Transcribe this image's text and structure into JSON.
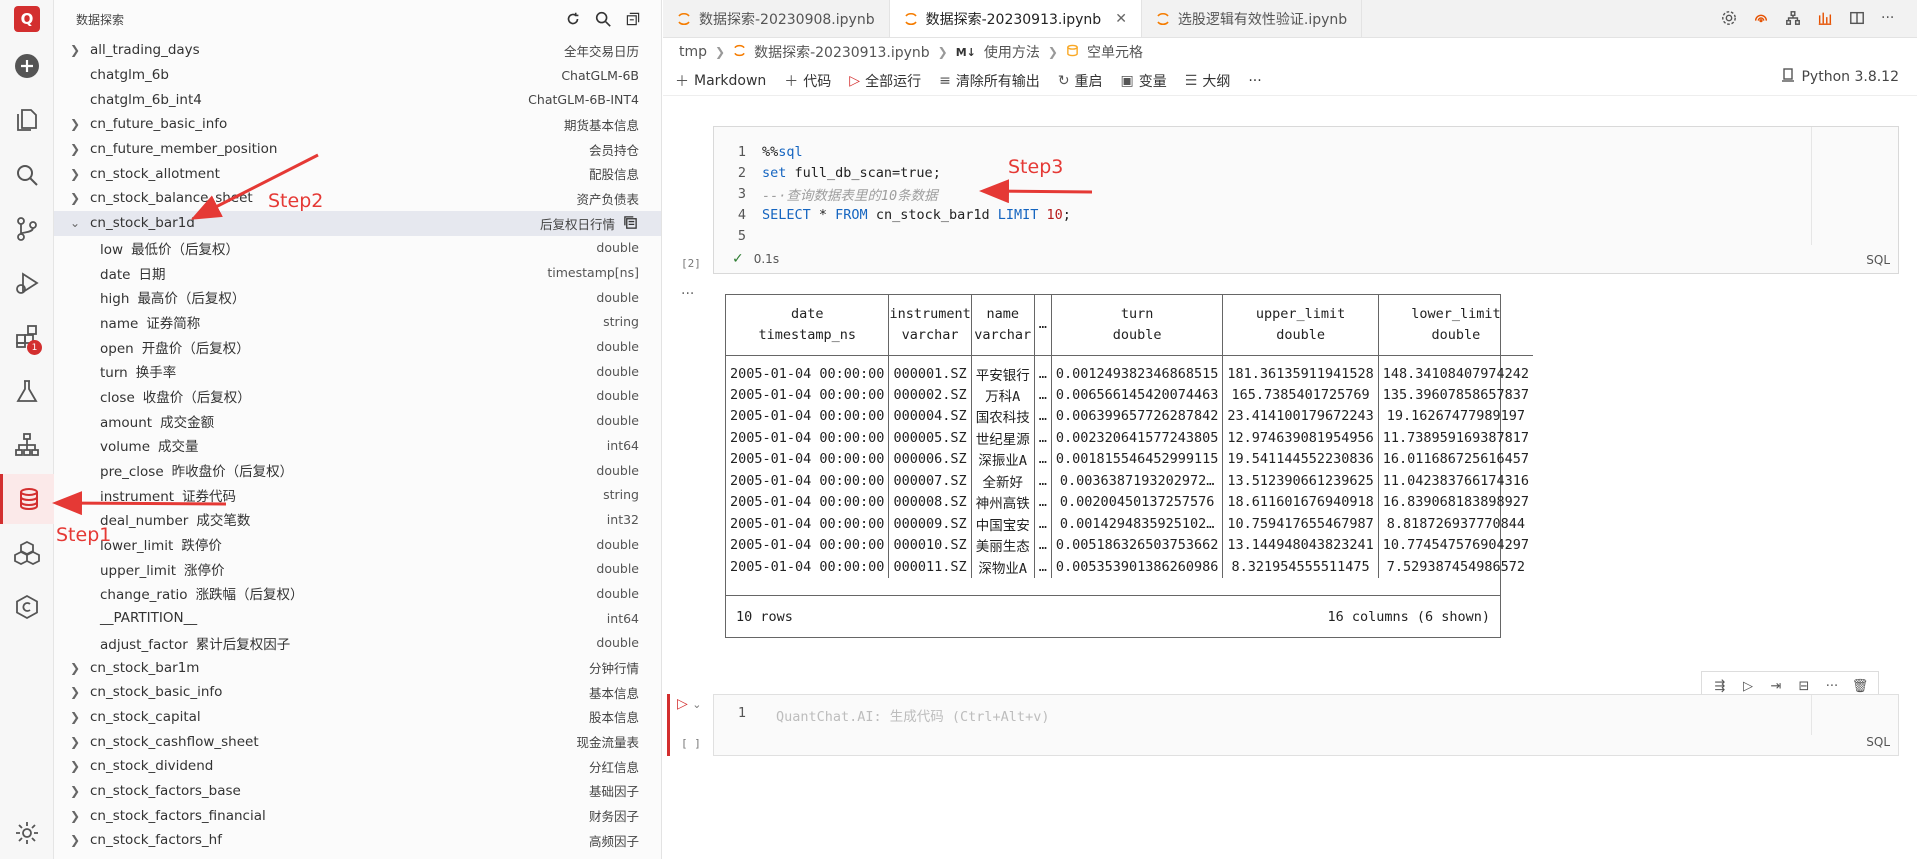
{
  "app": {
    "logo_text": "Q",
    "accent": "#d32f2f"
  },
  "activity_bar": {
    "extensions_badge": "1"
  },
  "sidebar": {
    "title": "数据探索",
    "tables_before": [
      {
        "name": "all_trading_days",
        "desc": "全年交易日历",
        "expandable": true
      },
      {
        "name": "chatglm_6b",
        "desc": "ChatGLM-6B",
        "expandable": false
      },
      {
        "name": "chatglm_6b_int4",
        "desc": "ChatGLM-6B-INT4",
        "expandable": false
      },
      {
        "name": "cn_future_basic_info",
        "desc": "期货基本信息",
        "expandable": true
      },
      {
        "name": "cn_future_member_position",
        "desc": "会员持仓",
        "expandable": true
      },
      {
        "name": "cn_stock_allotment",
        "desc": "配股信息",
        "expandable": true
      },
      {
        "name": "cn_stock_balance_sheet",
        "desc": "资产负债表",
        "expandable": true
      }
    ],
    "selected": {
      "name": "cn_stock_bar1d",
      "desc": "后复权日行情"
    },
    "columns": [
      {
        "field": "low",
        "cn": "最低价（后复权）",
        "type": "double"
      },
      {
        "field": "date",
        "cn": "日期",
        "type": "timestamp[ns]"
      },
      {
        "field": "high",
        "cn": "最高价（后复权）",
        "type": "double"
      },
      {
        "field": "name",
        "cn": "证券简称",
        "type": "string"
      },
      {
        "field": "open",
        "cn": "开盘价（后复权）",
        "type": "double"
      },
      {
        "field": "turn",
        "cn": "换手率",
        "type": "double"
      },
      {
        "field": "close",
        "cn": "收盘价（后复权）",
        "type": "double"
      },
      {
        "field": "amount",
        "cn": "成交金额",
        "type": "double"
      },
      {
        "field": "volume",
        "cn": "成交量",
        "type": "int64"
      },
      {
        "field": "pre_close",
        "cn": "昨收盘价（后复权）",
        "type": "double"
      },
      {
        "field": "instrument",
        "cn": "证券代码",
        "type": "string"
      },
      {
        "field": "deal_number",
        "cn": "成交笔数",
        "type": "int32"
      },
      {
        "field": "lower_limit",
        "cn": "跌停价",
        "type": "double"
      },
      {
        "field": "upper_limit",
        "cn": "涨停价",
        "type": "double"
      },
      {
        "field": "change_ratio",
        "cn": "涨跌幅（后复权）",
        "type": "double"
      },
      {
        "field": "__PARTITION__",
        "cn": "",
        "type": "int64"
      },
      {
        "field": "adjust_factor",
        "cn": "累计后复权因子",
        "type": "double"
      }
    ],
    "tables_after": [
      {
        "name": "cn_stock_bar1m",
        "desc": "分钟行情"
      },
      {
        "name": "cn_stock_basic_info",
        "desc": "基本信息"
      },
      {
        "name": "cn_stock_capital",
        "desc": "股本信息"
      },
      {
        "name": "cn_stock_cashflow_sheet",
        "desc": "现金流量表"
      },
      {
        "name": "cn_stock_dividend",
        "desc": "分红信息"
      },
      {
        "name": "cn_stock_factors_base",
        "desc": "基础因子"
      },
      {
        "name": "cn_stock_factors_financial",
        "desc": "财务因子"
      },
      {
        "name": "cn_stock_factors_hf",
        "desc": "高频因子"
      }
    ]
  },
  "tabs": [
    {
      "label": "数据探索-20230908.ipynb",
      "active": false
    },
    {
      "label": "数据探索-20230913.ipynb",
      "active": true
    },
    {
      "label": "选股逻辑有效性验证.ipynb",
      "active": false
    }
  ],
  "breadcrumb": {
    "root": "tmp",
    "file": "数据探索-20230913.ipynb",
    "m4": "M↓",
    "section": "使用方法",
    "cell": "空单元格"
  },
  "toolbar": {
    "markdown": "Markdown",
    "code": "代码",
    "run_all": "全部运行",
    "clear": "清除所有输出",
    "restart": "重启",
    "variables": "变量",
    "outline": "大纲",
    "more": "···",
    "kernel": "Python 3.8.12"
  },
  "cell1": {
    "lines": [
      {
        "n": "1"
      },
      {
        "n": "2"
      },
      {
        "n": "3"
      },
      {
        "n": "4"
      },
      {
        "n": "5"
      }
    ],
    "code": {
      "l1_magic": "%%",
      "l1_sql": "sql",
      "l2_set": "set",
      "l2_rest": " full_db_scan=true;",
      "l3_comment": "--·查询数据表里的10条数据",
      "l4_select": "SELECT",
      "l4_star": " * ",
      "l4_from": "FROM",
      "l4_table": " cn_stock_bar1d ",
      "l4_limit": "LIMIT",
      "l4_num": " 10",
      "l4_end": ";"
    },
    "exec_count": "[2]",
    "duration": "0.1s",
    "lang": "SQL",
    "more": "···"
  },
  "output": {
    "headers": [
      {
        "name": "date",
        "type": "timestamp_ns"
      },
      {
        "name": "instrument",
        "type": "varchar"
      },
      {
        "name": "name",
        "type": "varchar"
      },
      {
        "name": "…",
        "type": ""
      },
      {
        "name": "turn",
        "type": "double"
      },
      {
        "name": "upper_limit",
        "type": "double"
      },
      {
        "name": "lower_limit",
        "type": "double"
      }
    ],
    "rows": [
      [
        "2005-01-04 00:00:00",
        "000001.SZ",
        "平安银行",
        "…",
        "0.001249382346868515",
        "181.36135911941528",
        "148.34108407974242"
      ],
      [
        "2005-01-04 00:00:00",
        "000002.SZ",
        "万科A",
        "…",
        "0.006566145420074463",
        "165.7385401725769",
        "135.39607858657837"
      ],
      [
        "2005-01-04 00:00:00",
        "000004.SZ",
        "国农科技",
        "…",
        "0.006399657726287842",
        "23.414100179672243",
        "19.16267477989197"
      ],
      [
        "2005-01-04 00:00:00",
        "000005.SZ",
        "世纪星源",
        "…",
        "0.002320641577243805",
        "12.974639081954956",
        "11.738959169387817"
      ],
      [
        "2005-01-04 00:00:00",
        "000006.SZ",
        "深振业A",
        "…",
        "0.001815546452999115",
        "19.541144552230836",
        "16.011686725616457"
      ],
      [
        "2005-01-04 00:00:00",
        "000007.SZ",
        "全新好",
        "…",
        "0.0036387193202972…",
        "13.512390661239625",
        "11.042383766174316"
      ],
      [
        "2005-01-04 00:00:00",
        "000008.SZ",
        "神州高铁",
        "…",
        "0.00200450137257576",
        "18.611601676940918",
        "16.839068183898927"
      ],
      [
        "2005-01-04 00:00:00",
        "000009.SZ",
        "中国宝安",
        "…",
        "0.0014294835925102…",
        "10.759417655467987",
        "8.818726937770844"
      ],
      [
        "2005-01-04 00:00:00",
        "000010.SZ",
        "美丽生态",
        "…",
        "0.005186326503753662",
        "13.144948043823241",
        "10.774547576904297"
      ],
      [
        "2005-01-04 00:00:00",
        "000011.SZ",
        "深物业A",
        "…",
        "0.005353901386260986",
        "8.321954555511475",
        "7.529387454986572"
      ]
    ],
    "row_count": "10 rows",
    "col_count": "16 columns (6 shown)"
  },
  "cell2": {
    "line": "1",
    "placeholder": "QuantChat.AI: 生成代码 (Ctrl+Alt+v)",
    "exec_count": "[ ]",
    "lang": "SQL"
  },
  "annotations": {
    "step1": "Step1",
    "step2": "Step2",
    "step3": "Step3",
    "color": "#e53935"
  }
}
